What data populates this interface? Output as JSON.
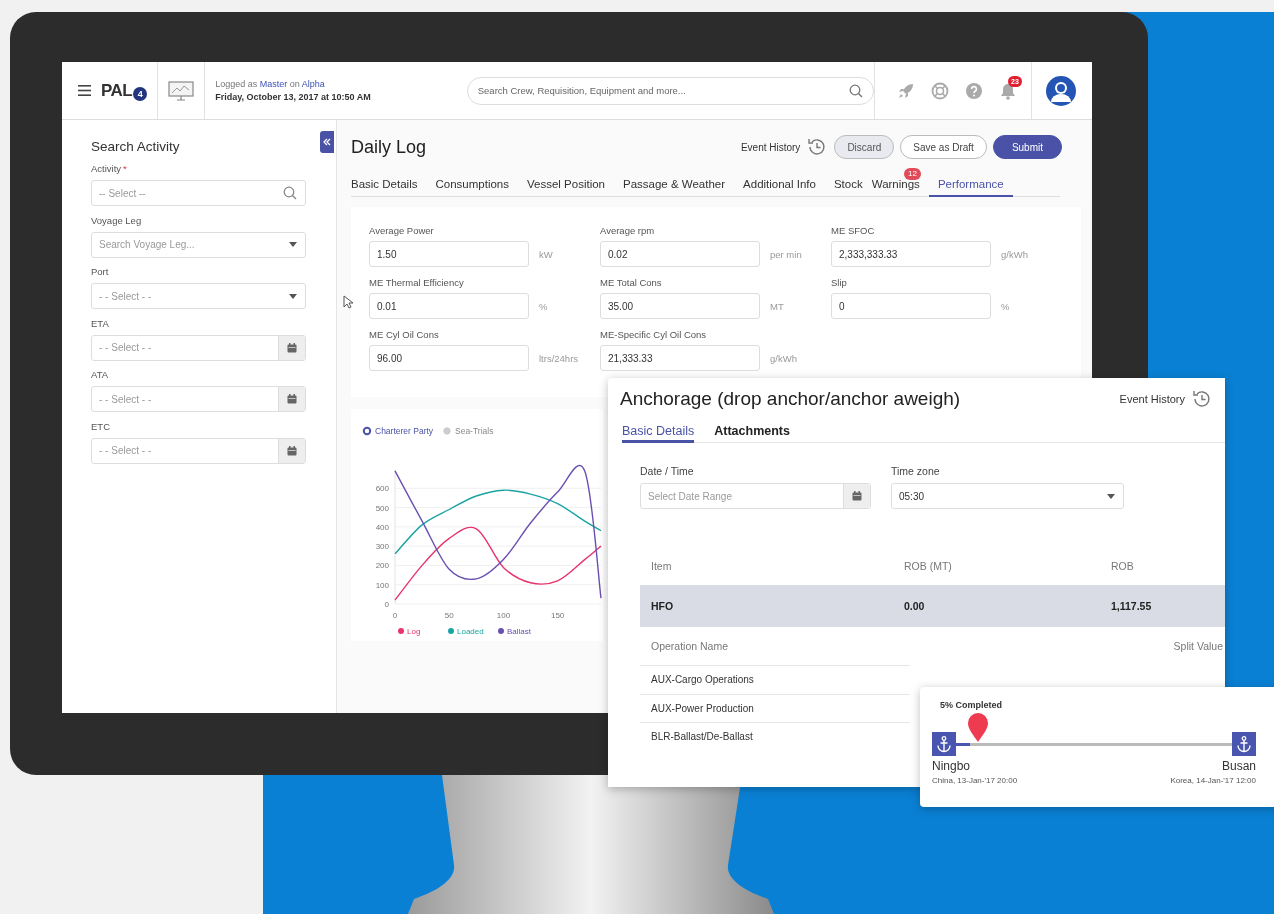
{
  "header": {
    "logo": {
      "text": "PAL",
      "badge": "4"
    },
    "login": {
      "prefix": "Logged as",
      "user": "Master",
      "middle": "on",
      "vessel": "Alpha"
    },
    "date": "Friday, October 13, 2017 at 10:50 AM",
    "search": {
      "placeholder": "Search Crew, Requisition, Equipment and more..."
    },
    "notifications": "23"
  },
  "sidebar": {
    "title": "Search Activity",
    "fields": [
      {
        "label": "Activity",
        "marker": "*",
        "kind": "search",
        "placeholder": "-- Select --"
      },
      {
        "label": "Voyage Leg",
        "kind": "combo",
        "placeholder": "Search Voyage Leg..."
      },
      {
        "label": "Port",
        "kind": "select",
        "placeholder": "- - Select - -"
      },
      {
        "label": "ETA",
        "kind": "date",
        "placeholder": "- - Select - -"
      },
      {
        "label": "ATA",
        "kind": "date",
        "placeholder": "- - Select - -"
      },
      {
        "label": "ETC",
        "kind": "date",
        "placeholder": "- - Select - -"
      }
    ]
  },
  "daily_log": {
    "title": "Daily Log",
    "event_history": "Event History",
    "buttons": [
      {
        "label": "Discard",
        "kind": "secondary"
      },
      {
        "label": "Save as Draft",
        "kind": "outline"
      },
      {
        "label": "Submit",
        "kind": "primary"
      }
    ],
    "tabs": [
      {
        "label": "Basic Details",
        "selected": false
      },
      {
        "label": "Consumptions",
        "selected": false
      },
      {
        "label": "Vessel Position",
        "selected": false
      },
      {
        "label": "Passage & Weather",
        "selected": false
      },
      {
        "label": "Additional Info",
        "selected": false
      },
      {
        "label": "Stock",
        "selected": false
      },
      {
        "label": "Warnings",
        "selected": false,
        "badge": "12"
      },
      {
        "label": "Performance",
        "selected": true
      }
    ],
    "fields": [
      {
        "label": "Average Power",
        "value": "1.50",
        "unit": "kW"
      },
      {
        "label": "Average rpm",
        "value": "0.02",
        "unit": "per min"
      },
      {
        "label": "ME SFOC",
        "value": "2,333,333.33",
        "unit": "g/kWh"
      },
      {
        "label": "ME Thermal Efficiency",
        "value": "0.01",
        "unit": "%"
      },
      {
        "label": "ME Total Cons",
        "value": "35.00",
        "unit": "MT"
      },
      {
        "label": "Slip",
        "value": "0",
        "unit": "%"
      },
      {
        "label": "ME Cyl Oil Cons",
        "value": "96.00",
        "unit": "ltrs/24hrs"
      },
      {
        "label": "ME-Specific Cyl Oil Cons",
        "value": "21,333.33",
        "unit": "g/kWh"
      }
    ]
  },
  "chart": {
    "modes": [
      {
        "label": "Charterer Party",
        "selected": true
      },
      {
        "label": "Sea-Trials",
        "selected": false
      }
    ],
    "chart_data": {
      "type": "line",
      "grid": true,
      "legend": "bottom",
      "x": [
        0,
        25,
        50,
        75,
        100,
        125,
        150,
        175,
        190
      ],
      "xlim": [
        0,
        190
      ],
      "ylim": [
        0,
        700
      ],
      "xticks": [
        0,
        50,
        100,
        150
      ],
      "yticks": [
        0,
        100,
        200,
        300,
        400,
        500,
        600
      ],
      "series": [
        {
          "name": "Log",
          "color": "#e8336b",
          "values": [
            20,
            200,
            340,
            390,
            190,
            110,
            120,
            230,
            300
          ]
        },
        {
          "name": "Loaded",
          "color": "#1aa3a3",
          "values": [
            260,
            410,
            490,
            560,
            590,
            570,
            520,
            430,
            380
          ]
        },
        {
          "name": "Ballast",
          "color": "#6a4fb0",
          "values": [
            690,
            430,
            180,
            130,
            230,
            420,
            580,
            690,
            30
          ]
        }
      ]
    }
  },
  "anchorage": {
    "title": "Anchorage (drop anchor/anchor aweigh)",
    "event_history": "Event History",
    "tabs": [
      {
        "label": "Basic Details",
        "selected": true
      },
      {
        "label": "Attachments",
        "selected": false
      }
    ],
    "date_field": {
      "label": "Date / Time",
      "placeholder": "Select Date Range"
    },
    "timezone": {
      "label": "Time zone",
      "value": "05:30"
    },
    "table": {
      "columns": [
        "Item",
        "ROB (MT)",
        "ROB"
      ],
      "rows": [
        {
          "cells": [
            "HFO",
            "0.00",
            "1,117.55"
          ],
          "selected": true
        }
      ]
    },
    "operations": {
      "columns": [
        "Operation Name",
        "Split Value"
      ],
      "rows": [
        "AUX-Cargo Operations",
        "AUX-Power Production",
        "BLR-Ballast/De-Ballast"
      ]
    }
  },
  "voyage": {
    "status": "5% Completed",
    "level": 0.05,
    "origin": {
      "port": "Ningbo",
      "detail": "China, 13-Jan-'17 20:00"
    },
    "destination": {
      "port": "Busan",
      "detail": "Korea, 14-Jan-'17 12:00"
    }
  }
}
